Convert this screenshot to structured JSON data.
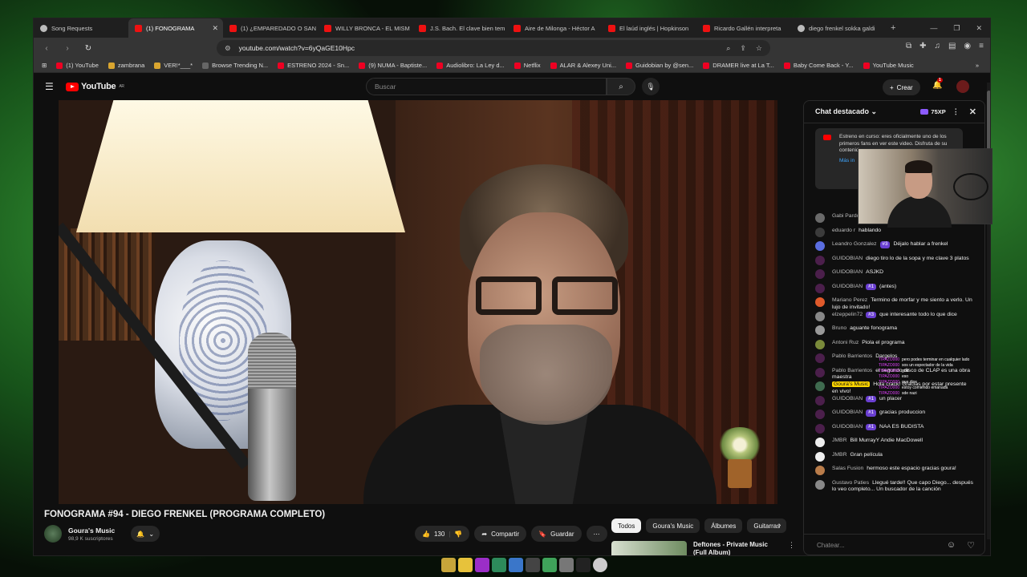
{
  "browser": {
    "tabs": [
      {
        "label": "Song Requests",
        "icon": "music-icon",
        "active": false
      },
      {
        "label": "(1) FONOGRAMA",
        "icon": "youtube-icon",
        "active": true
      },
      {
        "label": "(1) ¿EMPAREDADO O SAN",
        "icon": "youtube-icon",
        "active": false
      },
      {
        "label": "WILLY BRONCA - EL MISM",
        "icon": "youtube-icon",
        "active": false
      },
      {
        "label": "J.S. Bach. El clave bien tem",
        "icon": "youtube-icon",
        "active": false
      },
      {
        "label": "Aire de Milonga - Héctor A",
        "icon": "youtube-icon",
        "active": false
      },
      {
        "label": "El laúd inglés | Hopkinson",
        "icon": "youtube-icon",
        "active": false
      },
      {
        "label": "Ricardo Gallén interpreta",
        "icon": "youtube-icon",
        "active": false
      },
      {
        "label": "diego frenkel sokka galdi",
        "icon": "google-icon",
        "active": false
      }
    ],
    "url": "youtube.com/watch?v=6yQaGE10Hpc",
    "bookmarks": [
      "(1) YouTube",
      "zambrana",
      "VER!*___*",
      "Browse Trending N...",
      "ESTRENO 2024 - Sn...",
      "(9) NUMA - Baptiste...",
      "Audiolibro: La Ley d...",
      "Netflix",
      "ALAR & Alexey Uni...",
      "Guidobian by @sen...",
      "DRAMER live at La T...",
      "Baby Come Back - Y...",
      "YouTube Music"
    ]
  },
  "youtube": {
    "logo_text": "YouTube",
    "logo_region": "AR",
    "search_placeholder": "Buscar",
    "create_label": "Crear",
    "notif_count": "1"
  },
  "video": {
    "title": "FONOGRAMA #94 - DIEGO FRENKEL (PROGRAMA COMPLETO)",
    "channel": "Goura's Music",
    "subscribers": "98,9 K suscriptores",
    "likes": "130",
    "share_label": "Compartir",
    "save_label": "Guardar"
  },
  "chips": [
    "Todos",
    "Goura's Music",
    "Álbumes",
    "Guitarras"
  ],
  "recommendation": {
    "title": "Deftones - Private Music (Full Album)"
  },
  "chat": {
    "header": "Chat destacado",
    "xp": "75XP",
    "banner_text": "Estreno en curso: eres oficialmente uno de los primeros fans en ver este video. Disfruta de su contenido...",
    "banner_more": "Más in",
    "input_placeholder": "Chatear...",
    "messages": [
      {
        "author": "Gabi Pardo",
        "badge": "",
        "text": "este señor"
      },
      {
        "author": "eduardo r",
        "badge": "",
        "text": "hablando"
      },
      {
        "author": "Leandro Gonzalez",
        "badge": "#3",
        "text": "Déjalo hablar a frenkel"
      },
      {
        "author": "GUIDOBIAN",
        "badge": "",
        "text": "diego tiro lo de la sopa y me clave 3 platos"
      },
      {
        "author": "GUIDOBIAN",
        "badge": "",
        "text": "ASJKD"
      },
      {
        "author": "GUIDOBIAN",
        "badge": "#1",
        "text": "(antes)"
      },
      {
        "author": "Mariano Perez",
        "badge": "",
        "text": "Termino de morfar y me siento a verlo. Un lujo de invitado!"
      },
      {
        "author": "elzeppelin72",
        "badge": "#3",
        "text": "que interesante todo lo que dice"
      },
      {
        "author": "Bruno",
        "badge": "",
        "text": "aguante fonograma"
      },
      {
        "author": "Antoni Ruz",
        "badge": "",
        "text": "Piola el programa"
      },
      {
        "author": "Pablo Barrientos",
        "badge": "",
        "text": "Dargelos"
      },
      {
        "author": "Pablo Barrientos",
        "badge": "",
        "text": "el segundo disco de CLAP es una obra maestra"
      },
      {
        "author": "Goura's Music",
        "badge": "",
        "text": "Hola crack! Gracias por estar presente en vivo!"
      },
      {
        "author": "GUIDOBIAN",
        "badge": "#1",
        "text": "un placer"
      },
      {
        "author": "GUIDOBIAN",
        "badge": "#1",
        "text": "gracias produccion"
      },
      {
        "author": "GUIDOBIAN",
        "badge": "#1",
        "text": "NAA ES BUDISTA"
      },
      {
        "author": "JMBR",
        "badge": "",
        "text": "Bill MurrayY Andie MacDowell"
      },
      {
        "author": "JMBR",
        "badge": "",
        "text": "Gran película"
      },
      {
        "author": "Salas Fusion",
        "badge": "",
        "text": "hermoso este espacio gracias goura!"
      },
      {
        "author": "Gustavo Paties",
        "badge": "",
        "text": "Llegué tarde!! Que capo Diego... después lo veo completo... Un buscador de la canción"
      }
    ]
  },
  "stream_overlay": [
    {
      "user": "TIPAZO000",
      "text": "pero podes terminar en cualquier lado"
    },
    {
      "user": "TIPAZO000",
      "text": "sos un espectador de la vida"
    },
    {
      "user": "TIPAZO000",
      "text": "god"
    },
    {
      "user": "TIPAZO000",
      "text": "eso"
    },
    {
      "user": "TIPAZO000",
      "text": "que dice"
    },
    {
      "user": "TIPAZO000",
      "text": "estoy comiendo emanada"
    },
    {
      "user": "TIPAZO000",
      "text": "sde nazi"
    }
  ]
}
